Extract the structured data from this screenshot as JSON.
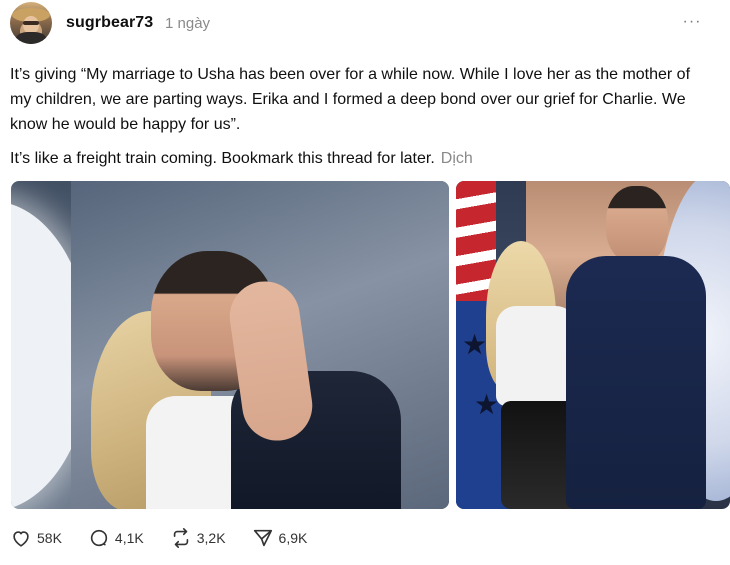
{
  "post": {
    "username": "sugrbear73",
    "timestamp": "1 ngày",
    "more_label": "···",
    "text_paragraph_1": "It’s giving “My marriage to Usha has been over for a while now. While I love her as the mother of my children, we are parting ways. Erika and I formed a deep bond over our grief for Charlie. We know he would be happy for us”.",
    "text_paragraph_2": "It’s like a freight train coming. Bookmark this thread for later.",
    "translate_label": "Dịch",
    "images": [
      {
        "alt": "photo-1"
      },
      {
        "alt": "photo-2"
      }
    ]
  },
  "actions": {
    "likes": "58K",
    "replies": "4,1K",
    "reposts": "3,2K",
    "shares": "6,9K"
  },
  "icons": {
    "like": "heart-icon",
    "reply": "comment-icon",
    "repost": "repost-icon",
    "share": "send-icon",
    "more": "more-icon"
  },
  "colors": {
    "text": "#101010",
    "muted": "#8a8a8a",
    "background": "#ffffff"
  }
}
